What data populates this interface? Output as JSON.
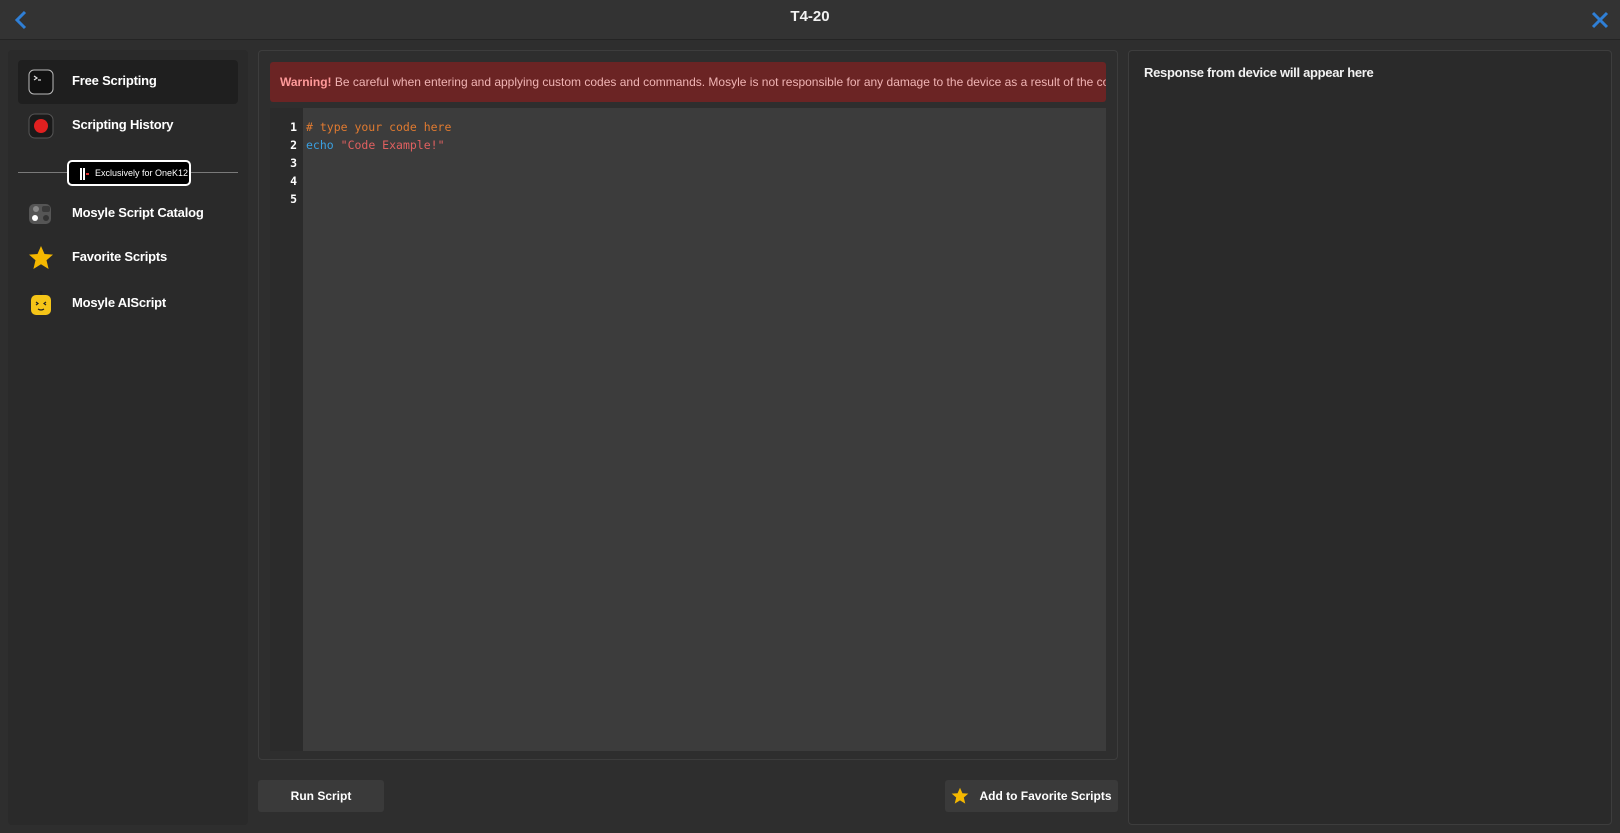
{
  "window": {
    "title": "T4-20",
    "back_icon": "chevron-left-icon",
    "close_icon": "close-icon",
    "accent_color": "#2f7fd6"
  },
  "sidebar": {
    "items": [
      {
        "label": "Free Scripting",
        "icon": "terminal-icon",
        "active": true
      },
      {
        "label": "Scripting History",
        "icon": "record-icon",
        "active": false
      },
      {
        "label": "Mosyle Script Catalog",
        "icon": "catalog-icon",
        "active": false
      },
      {
        "label": "Favorite Scripts",
        "icon": "star-icon",
        "active": false
      },
      {
        "label": "Mosyle AIScript",
        "icon": "robot-icon",
        "active": false
      }
    ],
    "badge": "Exclusively for OneK12"
  },
  "editor": {
    "warning_title": "Warning!",
    "warning_text": " Be careful when entering and applying custom codes and commands. Mosyle is not responsible for any damage to the device as a result of the code entered.",
    "line_numbers": [
      "1",
      "2",
      "3",
      "4",
      "5"
    ],
    "code_comment": "# type your code here",
    "code_keyword": "echo",
    "code_string": "\"Code Example!\""
  },
  "actions": {
    "run_label": "Run Script",
    "favorite_label": "Add to Favorite Scripts"
  },
  "response": {
    "placeholder": "Response from device will appear here"
  }
}
